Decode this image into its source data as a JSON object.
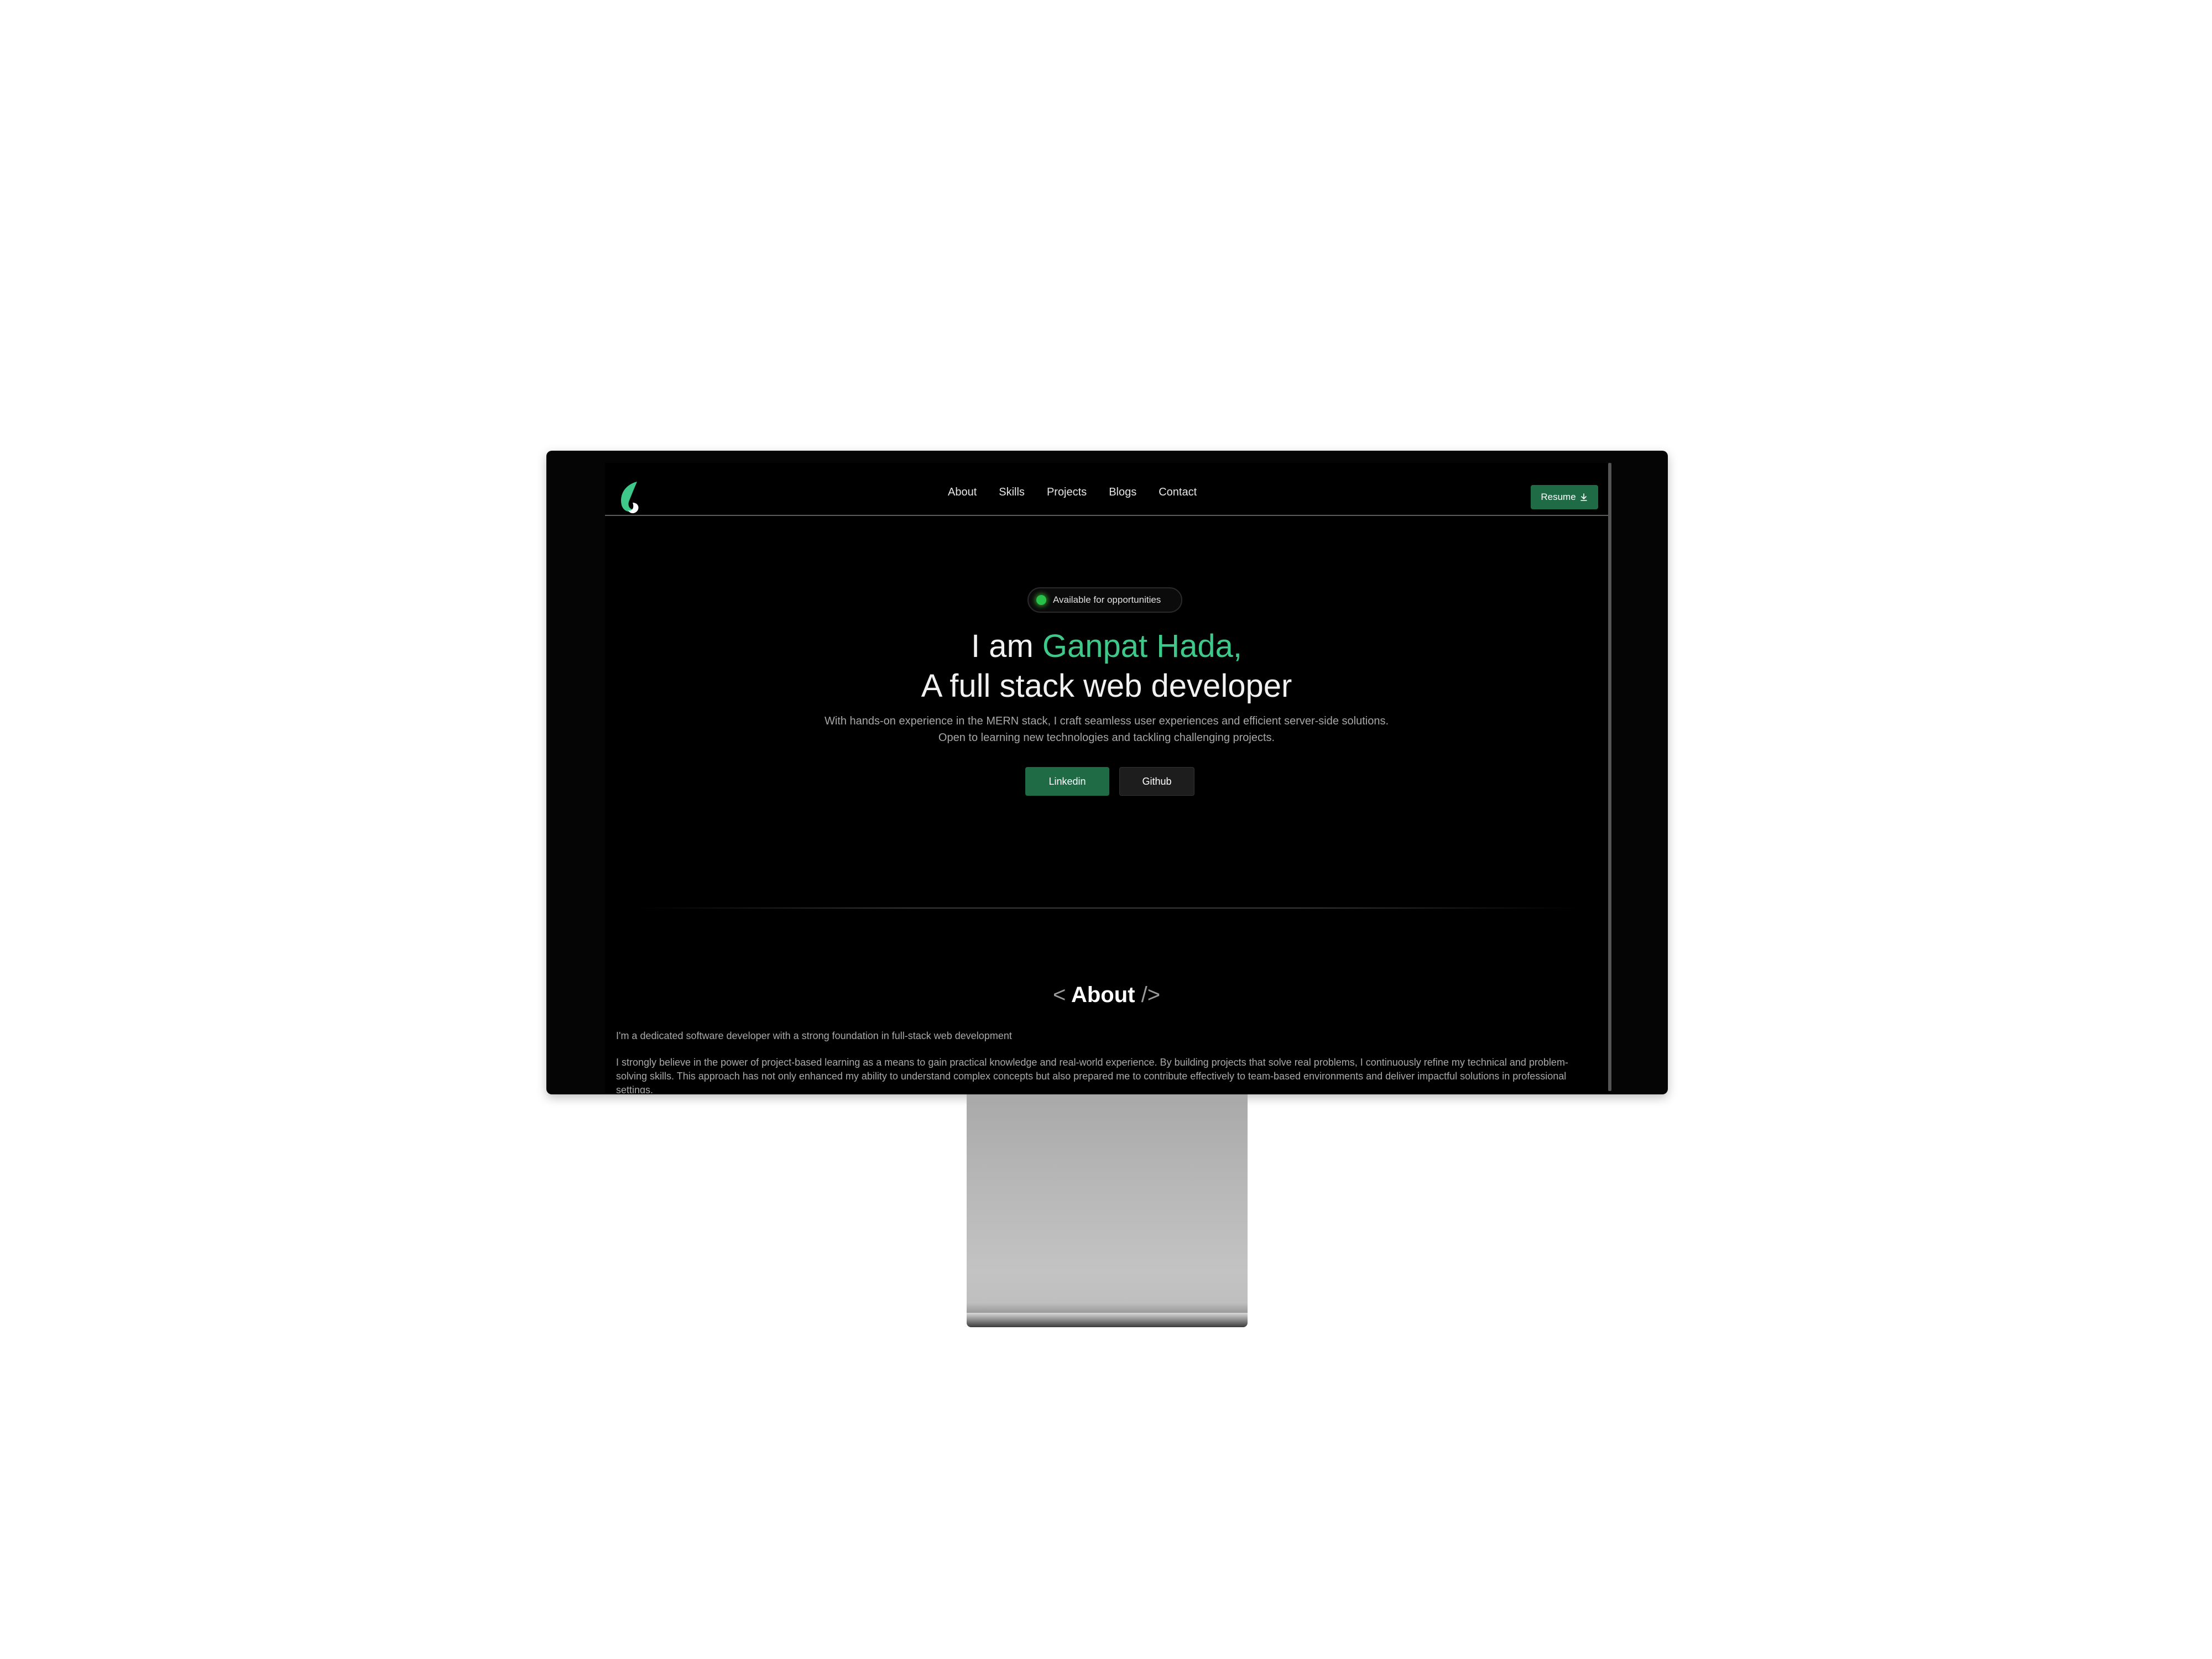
{
  "nav": {
    "links": [
      "About",
      "Skills",
      "Projects",
      "Blogs",
      "Contact"
    ],
    "resume_label": "Resume"
  },
  "hero": {
    "badge": "Available for opportunities",
    "title_prefix": "I am ",
    "title_name": "Ganpat Hada,",
    "title_line2": "A full stack web developer",
    "desc_line1": "With hands-on experience in the MERN stack, I craft seamless user experiences and efficient server-side solutions.",
    "desc_line2": "Open to learning new technologies and tackling challenging projects.",
    "linkedin_label": "Linkedin",
    "github_label": "Github"
  },
  "about": {
    "open_bracket": "<",
    "title": "About",
    "close_bracket": "/>",
    "para1": "I'm a dedicated software developer with a strong foundation in full-stack web development",
    "para2": "I strongly believe in the power of project-based learning as a means to gain practical knowledge and real-world experience. By building projects that solve real problems, I continuously refine my technical and problem-solving skills. This approach has not only enhanced my ability to understand complex concepts but also prepared me to contribute effectively to team-based environments and deliver impactful solutions in professional settings."
  },
  "colors": {
    "accent": "#3ec98a",
    "button_green": "#1e6b45",
    "background": "#000000",
    "badge_dot": "#27c14a"
  },
  "icons": {
    "logo": "logo-icon",
    "resume": "download-icon",
    "badge": "status-dot-icon"
  }
}
